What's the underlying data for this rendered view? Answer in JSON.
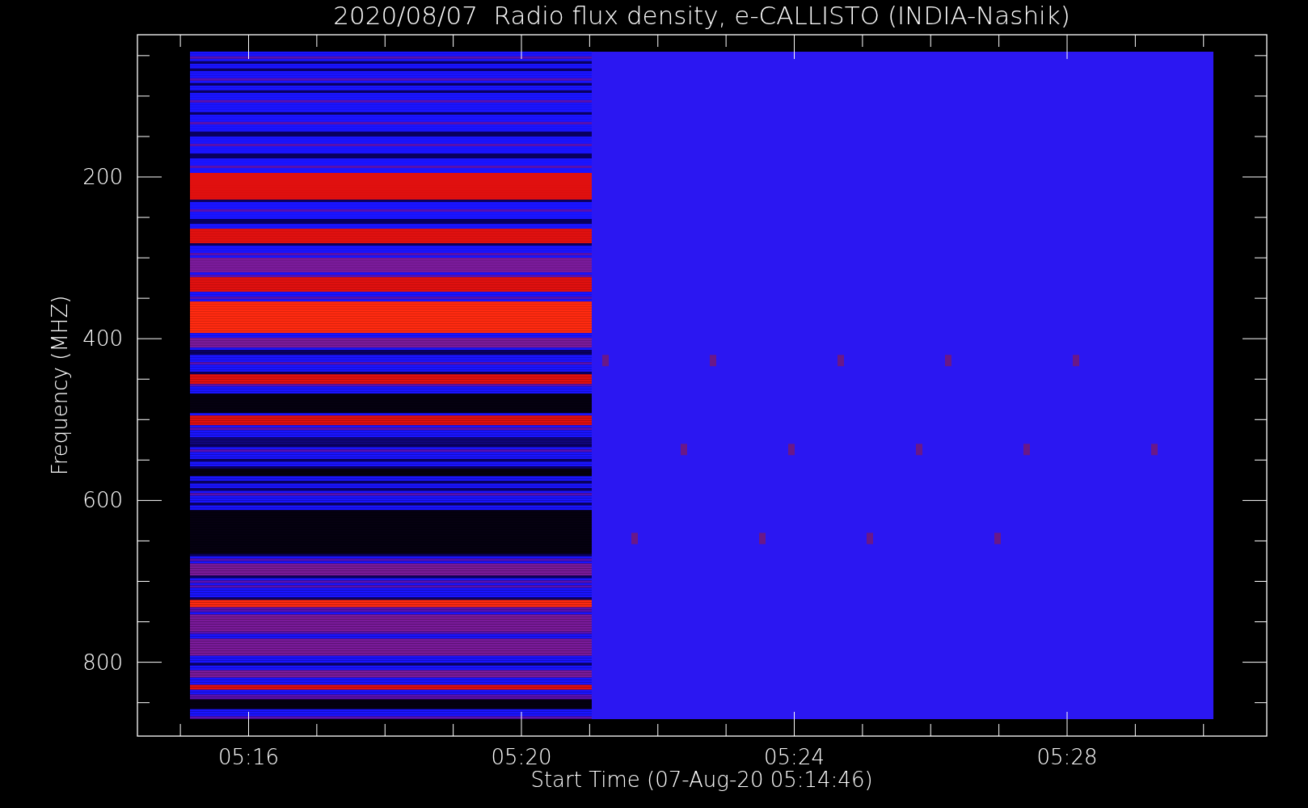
{
  "plot": {
    "title": "2020/08/07  Radio flux density, e-CALLISTO (INDIA-Nashik)",
    "ylabel": "Frequency (MHZ)",
    "xlabel": "Start Time (07-Aug-20 05:14:46)",
    "yticks": [
      "200",
      "400",
      "600",
      "800"
    ],
    "xticks": [
      "05:16",
      "05:20",
      "05:24",
      "05:28"
    ]
  }
}
